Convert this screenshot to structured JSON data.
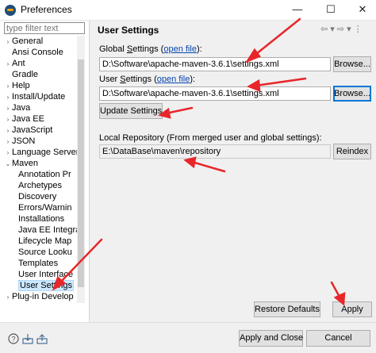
{
  "window": {
    "title": "Preferences",
    "minimize": "—",
    "maximize": "☐",
    "close": "✕"
  },
  "filter": {
    "placeholder": "type filter text"
  },
  "tree": [
    {
      "label": "General",
      "expander": "›"
    },
    {
      "label": "Ansi Console",
      "expander": ""
    },
    {
      "label": "Ant",
      "expander": "›"
    },
    {
      "label": "Gradle",
      "expander": ""
    },
    {
      "label": "Help",
      "expander": "›"
    },
    {
      "label": "Install/Update",
      "expander": "›"
    },
    {
      "label": "Java",
      "expander": "›"
    },
    {
      "label": "Java EE",
      "expander": "›"
    },
    {
      "label": "JavaScript",
      "expander": "›"
    },
    {
      "label": "JSON",
      "expander": "›"
    },
    {
      "label": "Language Server",
      "expander": "›"
    },
    {
      "label": "Maven",
      "expander": "⌄"
    },
    {
      "label": "Annotation Pr",
      "expander": ""
    },
    {
      "label": "Archetypes",
      "expander": ""
    },
    {
      "label": "Discovery",
      "expander": ""
    },
    {
      "label": "Errors/Warnin",
      "expander": ""
    },
    {
      "label": "Installations",
      "expander": ""
    },
    {
      "label": "Java EE Integra",
      "expander": ""
    },
    {
      "label": "Lifecycle Map",
      "expander": ""
    },
    {
      "label": "Source Looku",
      "expander": ""
    },
    {
      "label": "Templates",
      "expander": ""
    },
    {
      "label": "User Interface",
      "expander": ""
    },
    {
      "label": "User Settings",
      "expander": ""
    },
    {
      "label": "Plug-in Develop",
      "expander": "›"
    }
  ],
  "page": {
    "title": "User Settings",
    "nav": "⇦ ▾ ⇨ ▾ ⋮",
    "global_label_prefix": "Global ",
    "global_label_accel": "S",
    "global_label_middle": "ettings (",
    "global_link": "open file",
    "global_label_suffix": "):",
    "global_value": "D:\\Software\\apache-maven-3.6.1\\settings.xml",
    "browse1": "Browse...",
    "user_label_prefix": "User ",
    "user_label_accel": "S",
    "user_label_middle": "ettings (",
    "user_link": "open file",
    "user_label_suffix": "):",
    "user_value": "D:\\Software\\apache-maven-3.6.1\\settings.xml",
    "browse2": "Browse...",
    "update": "Update Settings",
    "local_repo_label": "Local Repository (From merged user and global settings):",
    "local_repo_value": "E:\\DataBase\\maven\\repository",
    "reindex": "Reindex",
    "restore_defaults": "Restore Defaults",
    "apply": "Apply"
  },
  "footer": {
    "apply_close": "Apply and Close",
    "cancel": "Cancel"
  },
  "colors": {
    "annotation_arrow": "#e8262a",
    "link": "#0645ad",
    "focus": "#0078d7"
  }
}
